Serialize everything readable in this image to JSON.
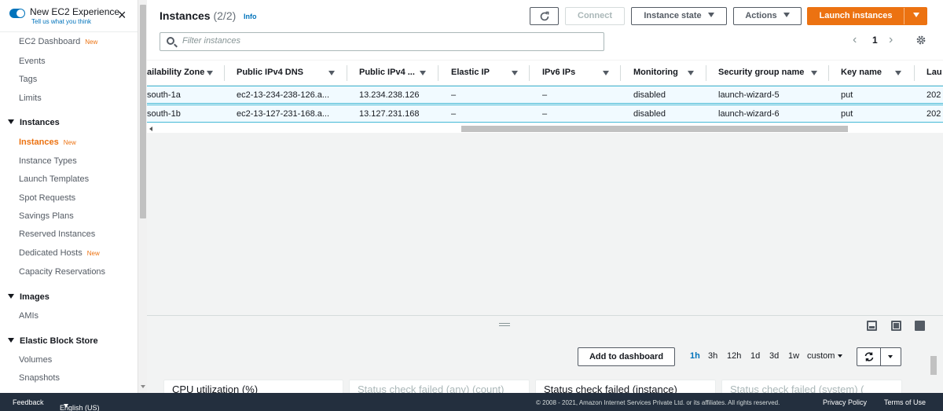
{
  "sidebar": {
    "experience_title": "New EC2 Experience",
    "experience_sub": "Tell us what you think",
    "close": "×",
    "dashboard": "EC2 Dashboard",
    "new_badge": "New",
    "events": "Events",
    "tags": "Tags",
    "limits": "Limits",
    "sec_instances": "Instances",
    "instances": "Instances",
    "instance_types": "Instance Types",
    "launch_templates": "Launch Templates",
    "spot_requests": "Spot Requests",
    "savings_plans": "Savings Plans",
    "reserved_instances": "Reserved Instances",
    "dedicated_hosts": "Dedicated Hosts",
    "capacity_reservations": "Capacity Reservations",
    "sec_images": "Images",
    "amis": "AMIs",
    "sec_ebs": "Elastic Block Store",
    "volumes": "Volumes",
    "snapshots": "Snapshots"
  },
  "header": {
    "title": "Instances",
    "count": "(2/2)",
    "info": "Info",
    "connect": "Connect",
    "instance_state": "Instance state",
    "actions": "Actions",
    "launch": "Launch instances",
    "search_placeholder": "Filter instances",
    "page": "1"
  },
  "table": {
    "columns": [
      "ailability Zone",
      "Public IPv4 DNS",
      "Public IPv4 ...",
      "Elastic IP",
      "IPv6 IPs",
      "Monitoring",
      "Security group name",
      "Key name",
      "Lau"
    ],
    "rows": [
      [
        "south-1a",
        "ec2-13-234-238-126.a...",
        "13.234.238.126",
        "–",
        "–",
        "disabled",
        "launch-wizard-5",
        "put",
        "202"
      ],
      [
        "south-1b",
        "ec2-13-127-231-168.a...",
        "13.127.231.168",
        "–",
        "–",
        "disabled",
        "launch-wizard-6",
        "put",
        "202"
      ]
    ]
  },
  "monitoring": {
    "add_to_dashboard": "Add to dashboard",
    "ranges": [
      "1h",
      "3h",
      "12h",
      "1d",
      "3d",
      "1w"
    ],
    "selected_range": "1h",
    "custom": "custom",
    "cards": [
      "CPU utilization (%)",
      "Status check failed (any) (count)",
      "Status check failed (instance)",
      "Status check failed (system) ("
    ]
  },
  "footer": {
    "feedback": "Feedback",
    "language": "English (US)",
    "copyright": "© 2008 - 2021, Amazon Internet Services Private Ltd. or its affiliates. All rights reserved.",
    "privacy": "Privacy Policy",
    "terms": "Terms of Use"
  },
  "colors": {
    "accent_orange": "#ec7211",
    "link_blue": "#0073bb",
    "selected_row": "#f1faff",
    "footer_bg": "#232f3e"
  }
}
